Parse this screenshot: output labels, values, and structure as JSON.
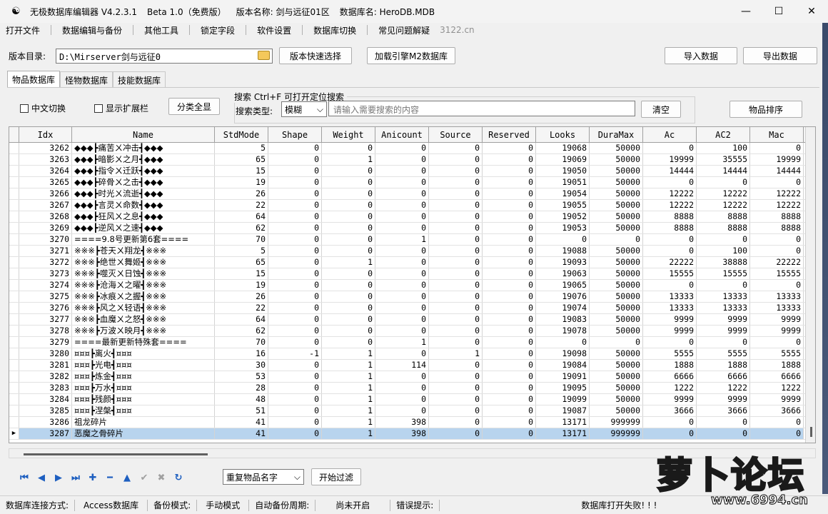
{
  "titlebar": {
    "segments": [
      "无极数据库编辑器 V4.2.3.1",
      "Beta 1.0（免费版）",
      "版本名称: 剑与远征01区",
      "数据库名: HeroDB.MDB"
    ],
    "minimize": "—",
    "maximize": "☐",
    "close": "✕"
  },
  "menu": {
    "items": [
      "打开文件",
      "数据编辑与备份",
      "其他工具",
      "锁定字段",
      "软件设置",
      "数据库切换",
      "常见问题解疑"
    ],
    "faded": "3122.cn"
  },
  "path_row": {
    "label": "版本目录:",
    "path_value": "D:\\Mirserver剑与远征0",
    "quick_select": "版本快速选择",
    "load_engine": "加载引擎M2数据库",
    "import": "导入数据",
    "export": "导出数据"
  },
  "tabs": [
    "物品数据库",
    "怪物数据库",
    "技能数据库"
  ],
  "filters": {
    "chinese_switch": "中文切换",
    "show_extended": "显示扩展栏",
    "show_all_categories": "分类全显",
    "search_group_title": "搜索  Ctrl+F 可打开定位搜索",
    "search_type_label": "搜索类型:",
    "search_type_value": "模糊",
    "search_placeholder": "请输入需要搜索的内容",
    "clear": "清空",
    "sort_items": "物品排序"
  },
  "grid": {
    "columns": [
      "Idx",
      "Name",
      "StdMode",
      "Shape",
      "Weight",
      "Anicount",
      "Source",
      "Reserved",
      "Looks",
      "DuraMax",
      "Ac",
      "AC2",
      "Mac"
    ],
    "rows": [
      [
        "3262",
        "◆◆◆┣痛苦ㄨ冲击┫◆◆◆",
        "5",
        "0",
        "0",
        "0",
        "0",
        "0",
        "19068",
        "50000",
        "0",
        "100",
        "0"
      ],
      [
        "3263",
        "◆◆◆┣暗影ㄨ之月┫◆◆◆",
        "65",
        "0",
        "1",
        "0",
        "0",
        "0",
        "19069",
        "50000",
        "19999",
        "35555",
        "19999"
      ],
      [
        "3264",
        "◆◆◆┣指令ㄨ迁跃┫◆◆◆",
        "15",
        "0",
        "0",
        "0",
        "0",
        "0",
        "19050",
        "50000",
        "14444",
        "14444",
        "14444"
      ],
      [
        "3265",
        "◆◆◆┣碎骨ㄨ之击┫◆◆◆",
        "19",
        "0",
        "0",
        "0",
        "0",
        "0",
        "19051",
        "50000",
        "0",
        "0",
        "0"
      ],
      [
        "3266",
        "◆◆◆┣时光ㄨ流逝┫◆◆◆",
        "26",
        "0",
        "0",
        "0",
        "0",
        "0",
        "19054",
        "50000",
        "12222",
        "12222",
        "12222"
      ],
      [
        "3267",
        "◆◆◆┣言灵ㄨ命数┫◆◆◆",
        "22",
        "0",
        "0",
        "0",
        "0",
        "0",
        "19055",
        "50000",
        "12222",
        "12222",
        "12222"
      ],
      [
        "3268",
        "◆◆◆┣狂风ㄨ之息┫◆◆◆",
        "64",
        "0",
        "0",
        "0",
        "0",
        "0",
        "19052",
        "50000",
        "8888",
        "8888",
        "8888"
      ],
      [
        "3269",
        "◆◆◆┣逆风ㄨ之速┫◆◆◆",
        "62",
        "0",
        "0",
        "0",
        "0",
        "0",
        "19053",
        "50000",
        "8888",
        "8888",
        "8888"
      ],
      [
        "3270",
        "====9.8号更新第6套====",
        "70",
        "0",
        "0",
        "1",
        "0",
        "0",
        "0",
        "0",
        "0",
        "0",
        "0"
      ],
      [
        "3271",
        "※※※┣苍天ㄨ翔龙┫※※※",
        "5",
        "0",
        "0",
        "0",
        "0",
        "0",
        "19088",
        "50000",
        "0",
        "100",
        "0"
      ],
      [
        "3272",
        "※※※┣绝世ㄨ舞姬┫※※※",
        "65",
        "0",
        "1",
        "0",
        "0",
        "0",
        "19093",
        "50000",
        "22222",
        "38888",
        "22222"
      ],
      [
        "3273",
        "※※※┣噬灭ㄨ日蚀┫※※※",
        "15",
        "0",
        "0",
        "0",
        "0",
        "0",
        "19063",
        "50000",
        "15555",
        "15555",
        "15555"
      ],
      [
        "3274",
        "※※※┣沧海ㄨ之曜┫※※※",
        "19",
        "0",
        "0",
        "0",
        "0",
        "0",
        "19065",
        "50000",
        "0",
        "0",
        "0"
      ],
      [
        "3275",
        "※※※┣冰痕ㄨ之握┫※※※",
        "26",
        "0",
        "0",
        "0",
        "0",
        "0",
        "19076",
        "50000",
        "13333",
        "13333",
        "13333"
      ],
      [
        "3276",
        "※※※┣风之ㄨ轻语┫※※※",
        "22",
        "0",
        "0",
        "0",
        "0",
        "0",
        "19074",
        "50000",
        "13333",
        "13333",
        "13333"
      ],
      [
        "3277",
        "※※※┣血魔ㄨ之怒┫※※※",
        "64",
        "0",
        "0",
        "0",
        "0",
        "0",
        "19083",
        "50000",
        "9999",
        "9999",
        "9999"
      ],
      [
        "3278",
        "※※※┣万波ㄨ映月┫※※※",
        "62",
        "0",
        "0",
        "0",
        "0",
        "0",
        "19078",
        "50000",
        "9999",
        "9999",
        "9999"
      ],
      [
        "3279",
        "====最新更新特殊套====",
        "70",
        "0",
        "0",
        "1",
        "0",
        "0",
        "0",
        "0",
        "0",
        "0",
        "0"
      ],
      [
        "3280",
        "¤¤¤┣离火┫¤¤¤",
        "16",
        "-1",
        "1",
        "0",
        "1",
        "0",
        "19098",
        "50000",
        "5555",
        "5555",
        "5555"
      ],
      [
        "3281",
        "¤¤¤┣光电┫¤¤¤",
        "30",
        "0",
        "1",
        "114",
        "0",
        "0",
        "19084",
        "50000",
        "1888",
        "1888",
        "1888"
      ],
      [
        "3282",
        "¤¤¤┣炼金┫¤¤¤",
        "53",
        "0",
        "1",
        "0",
        "0",
        "0",
        "19091",
        "50000",
        "6666",
        "6666",
        "6666"
      ],
      [
        "3283",
        "¤¤¤┣万水┫¤¤¤",
        "28",
        "0",
        "1",
        "0",
        "0",
        "0",
        "19095",
        "50000",
        "1222",
        "1222",
        "1222"
      ],
      [
        "3284",
        "¤¤¤┣残颜┫¤¤¤",
        "48",
        "0",
        "1",
        "0",
        "0",
        "0",
        "19099",
        "50000",
        "9999",
        "9999",
        "9999"
      ],
      [
        "3285",
        "¤¤¤┣涅槃┫¤¤¤",
        "51",
        "0",
        "1",
        "0",
        "0",
        "0",
        "19087",
        "50000",
        "3666",
        "3666",
        "3666"
      ],
      [
        "3286",
        "祖龙碎片",
        "41",
        "0",
        "1",
        "398",
        "0",
        "0",
        "13171",
        "999999",
        "0",
        "0",
        "0"
      ],
      [
        "3287",
        "恶魔之骨碎片",
        "41",
        "0",
        "1",
        "398",
        "0",
        "0",
        "13171",
        "999999",
        "0",
        "0",
        "0"
      ]
    ],
    "selected_index": 25
  },
  "nav": {
    "buttons": [
      "first-record",
      "prev-record",
      "next-record",
      "last-record",
      "insert-record",
      "delete-record",
      "edit-record",
      "post-edit",
      "cancel-edit",
      "refresh-data"
    ],
    "duplicate_select": "重复物品名字",
    "start_filter": "开始过滤"
  },
  "status": {
    "conn_label": "数据库连接方式:",
    "conn_value": "Access数据库",
    "backup_label": "备份模式:",
    "backup_value": "手动模式",
    "auto_label": "自动备份周期:",
    "auto_value": "尚未开启",
    "error_label": "错误提示:",
    "message": "数据库打开失败! ! !"
  },
  "watermark": {
    "text": "萝卜论坛",
    "url": "www.6994.cn"
  }
}
